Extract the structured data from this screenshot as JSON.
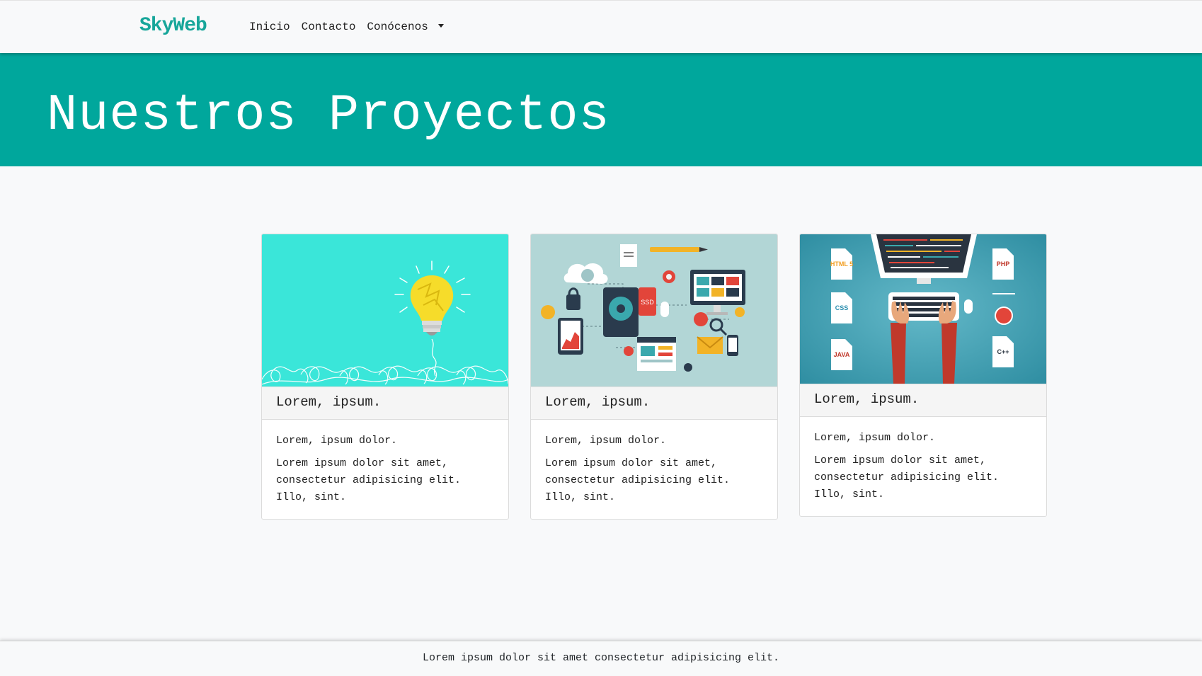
{
  "nav": {
    "brand": "SkyWeb",
    "links": [
      "Inicio",
      "Contacto",
      "Conócenos"
    ]
  },
  "hero": {
    "title": "Nuestros Proyectos"
  },
  "cards": [
    {
      "header": "Lorem, ipsum.",
      "subtitle": "Lorem, ipsum dolor.",
      "text": "Lorem ipsum dolor sit amet, consectetur adipisicing elit. Illo, sint.",
      "image": "lightbulb-illustration"
    },
    {
      "header": "Lorem, ipsum.",
      "subtitle": "Lorem, ipsum dolor.",
      "text": "Lorem ipsum dolor sit amet, consectetur adipisicing elit. Illo, sint.",
      "image": "tech-devices-illustration"
    },
    {
      "header": "Lorem, ipsum.",
      "subtitle": "Lorem, ipsum dolor.",
      "text": "Lorem ipsum dolor sit amet, consectetur adipisicing elit. Illo, sint.",
      "image": "coding-desk-illustration"
    }
  ],
  "code_badges": [
    "HTML 5",
    "PHP",
    "CSS",
    "JAVA",
    "C++"
  ],
  "device_labels": {
    "ssd": "SSD"
  },
  "footer": {
    "text": "Lorem ipsum dolor sit amet consectetur adipisicing elit."
  },
  "colors": {
    "accent": "#00a79c",
    "brand": "#17a69a"
  }
}
